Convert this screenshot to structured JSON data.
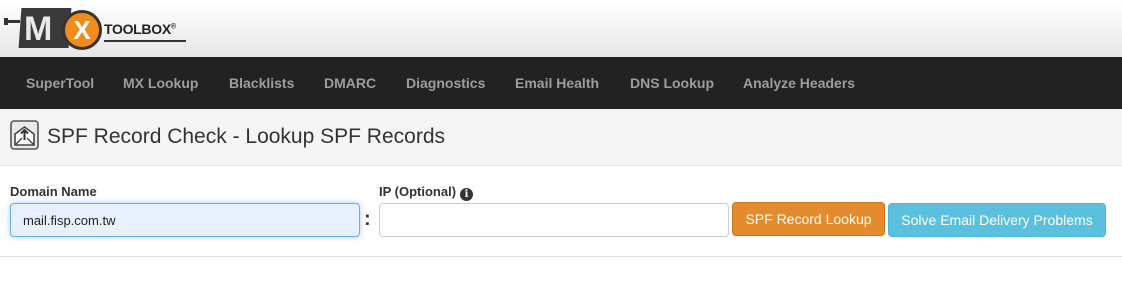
{
  "logo": {
    "mark_m": "M",
    "mark_x": "X",
    "text": "TOOLBOX",
    "registered": "®"
  },
  "nav": {
    "items": [
      {
        "label": "SuperTool"
      },
      {
        "label": "MX Lookup"
      },
      {
        "label": "Blacklists"
      },
      {
        "label": "DMARC"
      },
      {
        "label": "Diagnostics"
      },
      {
        "label": "Email Health"
      },
      {
        "label": "DNS Lookup"
      },
      {
        "label": "Analyze Headers"
      }
    ]
  },
  "page": {
    "title": "SPF Record Check - Lookup SPF Records",
    "title_icon": "envelope-upload-icon"
  },
  "form": {
    "domain_label": "Domain Name",
    "domain_value": "mail.fisp.com.tw",
    "separator": ":",
    "ip_label": "IP (Optional)",
    "ip_info_glyph": "i",
    "ip_value": "",
    "lookup_button": "SPF Record Lookup",
    "solve_button": "Solve Email Delivery Problems"
  },
  "colors": {
    "nav_bg": "#222222",
    "nav_text": "#9d9d9d",
    "lookup_button": "#e38b2d",
    "solve_button": "#5bc0de",
    "logo_orange": "#f08c1a"
  }
}
